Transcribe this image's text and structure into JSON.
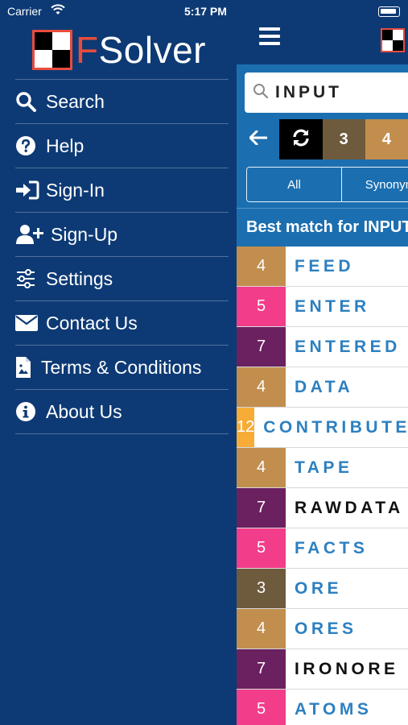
{
  "statusbar": {
    "carrier": "Carrier",
    "time": "5:17 PM"
  },
  "drawer": {
    "brand": {
      "first_letter": "F",
      "rest": "Solver"
    },
    "menu": [
      {
        "label": "Search",
        "icon": "search-icon"
      },
      {
        "label": "Help",
        "icon": "help-circle-icon"
      },
      {
        "label": "Sign-In",
        "icon": "sign-in-icon"
      },
      {
        "label": "Sign-Up",
        "icon": "user-plus-icon"
      },
      {
        "label": "Settings",
        "icon": "sliders-icon"
      },
      {
        "label": "Contact Us",
        "icon": "envelope-icon"
      },
      {
        "label": "Terms & Conditions",
        "icon": "document-icon"
      },
      {
        "label": "About Us",
        "icon": "info-circle-icon"
      }
    ]
  },
  "main": {
    "search": {
      "value": "INPUT"
    },
    "length_tabs": [
      "3",
      "4"
    ],
    "filter_tabs": [
      "All",
      "Synonym"
    ],
    "best_match_label": "Best match for INPUT",
    "results": [
      {
        "count": "4",
        "word": "FEED",
        "color": "#c28e4e",
        "style": "blue"
      },
      {
        "count": "5",
        "word": "ENTER",
        "color": "#f23d8a",
        "style": "blue"
      },
      {
        "count": "7",
        "word": "ENTERED",
        "color": "#6b2060",
        "style": "blue"
      },
      {
        "count": "4",
        "word": "DATA",
        "color": "#c28e4e",
        "style": "blue"
      },
      {
        "count": "12",
        "word": "CONTRIBUTE",
        "color": "#f7ac37",
        "style": "blue"
      },
      {
        "count": "4",
        "word": "TAPE",
        "color": "#c28e4e",
        "style": "blue"
      },
      {
        "count": "7",
        "word": "RAWDATA",
        "color": "#6b2060",
        "style": "black"
      },
      {
        "count": "5",
        "word": "FACTS",
        "color": "#f23d8a",
        "style": "blue"
      },
      {
        "count": "3",
        "word": "ORE",
        "color": "#6e5a3c",
        "style": "blue"
      },
      {
        "count": "4",
        "word": "ORES",
        "color": "#c28e4e",
        "style": "blue"
      },
      {
        "count": "7",
        "word": "IRONORE",
        "color": "#6b2060",
        "style": "black"
      },
      {
        "count": "5",
        "word": "ATOMS",
        "color": "#f23d8a",
        "style": "blue"
      }
    ]
  },
  "colors": {
    "navy": "#0d3a75",
    "blue": "#1b6fb0",
    "brand_red": "#e84c3d"
  }
}
